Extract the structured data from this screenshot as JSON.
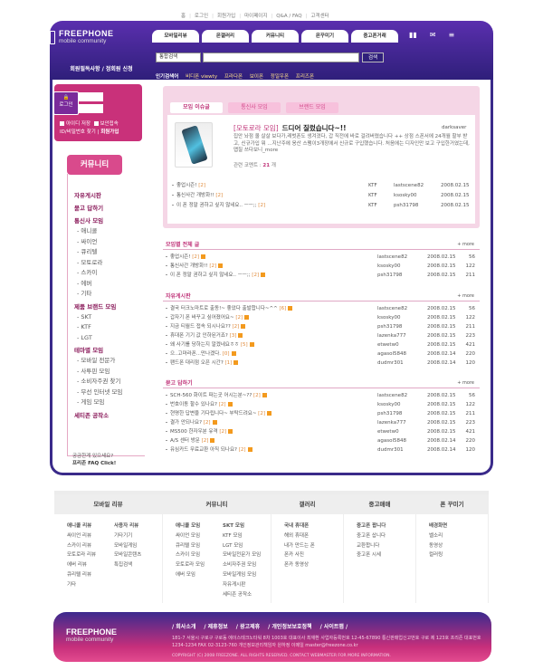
{
  "topnav": [
    "홈",
    "로그인",
    "회원가입",
    "마이페이지",
    "Q&A / FAQ",
    "고객센터"
  ],
  "logo": {
    "title": "FREEPHONE",
    "subtitle": "mobile community"
  },
  "mainnav": [
    "모바일리뷰",
    "몬갤러리",
    "커뮤니티",
    "몬꾸미기",
    "중고폰거래"
  ],
  "login_banner": "회원필독사항 / 정회원 신청",
  "search": {
    "select": "통합검색",
    "button": "검색"
  },
  "popular": {
    "label": "인기검색어",
    "keywords": [
      "비디폰 viewty",
      "프라다폰",
      "보이폰",
      "정일우폰",
      "프리즈폰"
    ]
  },
  "login": {
    "button": "로그인",
    "save_id": "아이디 저장",
    "secure": "보안접속",
    "find": "ID/비밀번호 찾기",
    "join": "회원가입"
  },
  "community_title": "커뮤니티",
  "left_menu": [
    {
      "type": "h",
      "label": "자유게시판"
    },
    {
      "type": "h",
      "label": "묻고 답하기"
    },
    {
      "type": "h",
      "label": "통신사 모임"
    },
    {
      "type": "s",
      "label": "- 애니콜"
    },
    {
      "type": "s",
      "label": "- 싸이언"
    },
    {
      "type": "s",
      "label": "- 큐리텔"
    },
    {
      "type": "s",
      "label": "- 모토로라"
    },
    {
      "type": "s",
      "label": "- 스카이"
    },
    {
      "type": "s",
      "label": "- 에버"
    },
    {
      "type": "s",
      "label": "- 기타"
    },
    {
      "type": "h",
      "label": "제품 브랜드 모임"
    },
    {
      "type": "s",
      "label": "- SKT"
    },
    {
      "type": "s",
      "label": "- KTF"
    },
    {
      "type": "s",
      "label": "- LGT"
    },
    {
      "type": "h",
      "label": "테마별 모임"
    },
    {
      "type": "s",
      "label": "- 모바일 전문가"
    },
    {
      "type": "s",
      "label": "- 사투핀 모임"
    },
    {
      "type": "s",
      "label": "- 소비자주권 찾기"
    },
    {
      "type": "s",
      "label": "- 무선 인터넷 모임"
    },
    {
      "type": "s",
      "label": "- 게임 모임"
    },
    {
      "type": "h",
      "label": "세티존 공작소"
    }
  ],
  "left_help": {
    "line1": "궁금한게 있으세요?",
    "line2": "프리존 FAQ Click!"
  },
  "feature": {
    "tabs": [
      "모임 이슈글",
      "통신사 모임",
      "브랜드 모임"
    ],
    "tag": "[모토로라 모임]",
    "title": "드디어 질렀습니다~!!",
    "author": "darksaver",
    "body": "집안 놔점 올 살살 보다가,레벗폰도 생겨겼다, 갑 직전에 바로 걸려버렸습니다 ++ 상점 스폰서에 24개월 할부 받고, 신규가입 뭐 ...지난주에 옹산 스팸이3개장에서 신규로 구입했습니다. 처음에는 디자인만 보고 구입한거였는데, 맵질 쓰다보니_more",
    "comment_label": "관련 코멘트 :",
    "comment_count": "21",
    "comment_unit": "개",
    "posts": [
      {
        "title": "좋업시즌!",
        "count": "[2]",
        "carrier": "KTF",
        "author": "lastscene82",
        "date": "2008.02.15"
      },
      {
        "title": "통신사간 개방화!!",
        "count": "[2]",
        "carrier": "KTF",
        "author": "ksosky00",
        "date": "2008.02.15"
      },
      {
        "title": "이 폰 정말 권하고 싶지 않네요.. ㅡㅡ;;",
        "count": "[2]",
        "carrier": "KTF",
        "author": "psh31798",
        "date": "2008.02.15"
      }
    ]
  },
  "sections": [
    {
      "title": "모임별 전체 글",
      "more": "+ more",
      "rows": [
        {
          "title": "좋업시즌!",
          "count": "[2]",
          "author": "lastscene82",
          "date": "2008.02.15",
          "hits": "56"
        },
        {
          "title": "통신사간 개방화!!",
          "count": "[2]",
          "author": "ksosky00",
          "date": "2008.02.15",
          "hits": "122"
        },
        {
          "title": "이 폰 정말 권하고 싶지 않네요.. ㅡㅡ;;",
          "count": "[2]",
          "author": "psh31798",
          "date": "2008.02.15",
          "hits": "211"
        }
      ]
    },
    {
      "title": "자유게시판",
      "more": "+ more",
      "rows": [
        {
          "title": "결국 터크노마트로 출동!~ 좋았다 출발합니다~^^",
          "count": "[6]",
          "author": "lastscene82",
          "date": "2008.02.15",
          "hits": "56"
        },
        {
          "title": "갑자기 폰 바꾸고 싶어졌어요~",
          "count": "[2]",
          "author": "ksosky00",
          "date": "2008.02.15",
          "hits": "122"
        },
        {
          "title": "지금 티월드 접속 되시나요??",
          "count": "[2]",
          "author": "psh31798",
          "date": "2008.02.15",
          "hits": "211"
        },
        {
          "title": "휴대폰 기기 값 인하된거죠?",
          "count": "[3]",
          "author": "lazenka777",
          "date": "2008.02.15",
          "hits": "223"
        },
        {
          "title": "왜 사기를 당하는지 알겠네요ㅎㅎ",
          "count": "[5]",
          "author": "etwetw0",
          "date": "2008.02.15",
          "hits": "421"
        },
        {
          "title": "으..고마라폰...만나겠다.",
          "count": "[0]",
          "author": "agasol5848",
          "date": "2008.02.14",
          "hits": "220"
        },
        {
          "title": "팬드폰 대리점 오픈 시간?",
          "count": "[1]",
          "author": "dudmr301",
          "date": "2008.02.14",
          "hits": "120"
        }
      ]
    },
    {
      "title": "묻고 답하기",
      "more": "+ more",
      "rows": [
        {
          "title": "SCH-560 화이트 파는곳 어시는분~??",
          "count": "[2]",
          "author": "lastscene82",
          "date": "2008.02.15",
          "hits": "56"
        },
        {
          "title": "번호이동 할수 있나요?",
          "count": "[2]",
          "author": "ksosky00",
          "date": "2008.02.15",
          "hits": "122"
        },
        {
          "title": "현명한 답변을 기다립니다~ 부탁드려요~",
          "count": "[2]",
          "author": "psh31798",
          "date": "2008.02.15",
          "hits": "211"
        },
        {
          "title": "결가 안되나요?",
          "count": "[2]",
          "author": "lazenka777",
          "date": "2008.02.15",
          "hits": "223"
        },
        {
          "title": "MS500 한자우분 유격",
          "count": "[2]",
          "author": "etwetw0",
          "date": "2008.02.15",
          "hits": "421"
        },
        {
          "title": "A/S 센터 방문",
          "count": "[2]",
          "author": "agasol5848",
          "date": "2008.02.14",
          "hits": "220"
        },
        {
          "title": "유심카드 무료교환 아직 되나요?",
          "count": "[2]",
          "author": "dudmr301",
          "date": "2008.02.14",
          "hits": "120"
        }
      ]
    }
  ],
  "footer_cols": [
    {
      "title": "모바일 리뷰",
      "lists": [
        [
          "애니콜 리뷰",
          "싸이언 리뷰",
          "스카이 리뷰",
          "모토로라 리뷰",
          "에버 리뷰",
          "큐리텔 리뷰",
          "기타"
        ],
        [
          "사용자 리뷰",
          "기타기기",
          "모바일게임",
          "모바일콘텐츠",
          "특집검색"
        ]
      ]
    },
    {
      "title": "커뮤니티",
      "lists": [
        [
          "애니콜 모임",
          "싸이언 모임",
          "큐리텔 모임",
          "스카이 모임",
          "모토로라 모임",
          "에버 모임"
        ],
        [
          "SKT 모임",
          "KTF 모임",
          "LGT 모임",
          "모바일전문가 모임",
          "소비자주권 모임",
          "모바일게임 모임",
          "자유게시판",
          "세티존 공작소"
        ]
      ]
    },
    {
      "title": "갤러리",
      "lists": [
        [
          "국내 휴대폰",
          "해외 휴대폰",
          "내가 만드는 폰",
          "폰카 사진",
          "폰카 동영상"
        ]
      ]
    },
    {
      "title": "중고매매",
      "lists": [
        [
          "중고폰 팝니다",
          "중고폰 삽니다",
          "교환합니다",
          "중고폰 시세"
        ]
      ]
    },
    {
      "title": "폰 꾸미기",
      "lists": [
        [
          "배경화면",
          "벨소리",
          "동영상",
          "컬러링"
        ]
      ]
    }
  ],
  "footer": {
    "links": [
      "/ 회사소개",
      "/ 제휴정보",
      "/ 광고제휴",
      "/ 개인정보보호정책",
      "/ 사이트맵 /"
    ],
    "address": "181-7 서울시 구로구 구로동 에이스테크노타워 8차 1003호  대표이사 최재환  사업자등록번호 12-45-67890  통신판매업신고번호 구로 제 123호 프리존 대표번호 1234-1234  FAX 02-3123-760  개인정보관리책임자 원하정  이메일 master@freezone.co.kr",
    "copyright": "COPYRIGHT (C) 2008 FREEZONE. ALL RIGHTS RESERVED. CONTACT WEBMASTER FOR MORE INFORMATION."
  }
}
